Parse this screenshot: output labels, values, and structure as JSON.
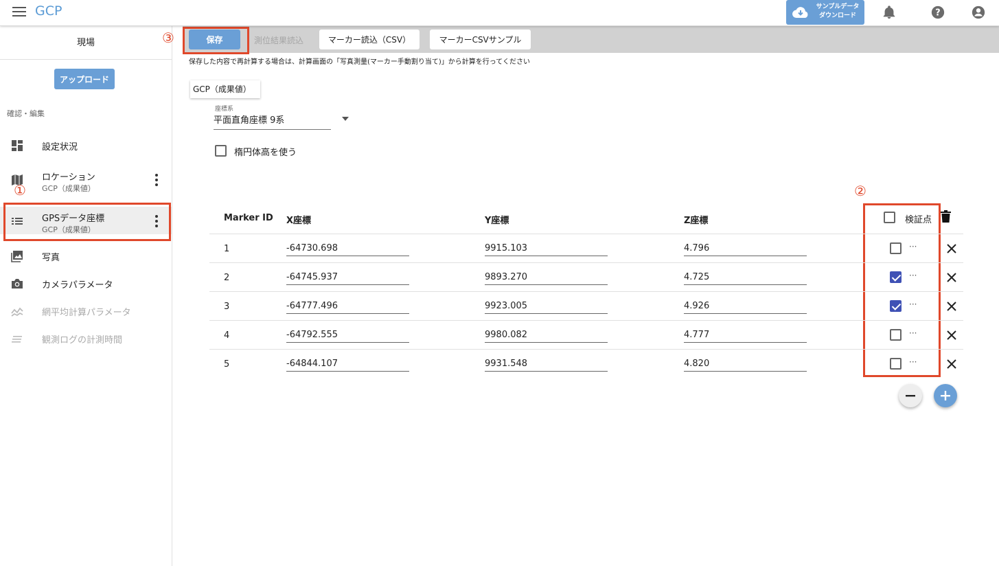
{
  "header": {
    "app_title": "GCP",
    "download_line1": "サンプルデータ",
    "download_line2": "ダウンロード"
  },
  "sidebar": {
    "site_label": "現場",
    "upload_label": "アップロード",
    "section_label": "確認・編集",
    "items": [
      {
        "label": "設定状況",
        "sub": "",
        "icon": "dashboard-icon"
      },
      {
        "label": "ロケーション",
        "sub": "GCP（成果値）",
        "icon": "map-icon"
      },
      {
        "label": "GPSデータ座標",
        "sub": "GCP（成果値）",
        "icon": "list-icon"
      },
      {
        "label": "写真",
        "sub": "",
        "icon": "photo-icon"
      },
      {
        "label": "カメラパラメータ",
        "sub": "",
        "icon": "camera-icon"
      },
      {
        "label": "網平均計算パラメータ",
        "sub": "",
        "icon": "network-icon"
      },
      {
        "label": "観測ログの計測時間",
        "sub": "",
        "icon": "log-lines-icon"
      }
    ]
  },
  "annotations": {
    "one": "①",
    "two": "②",
    "three": "③"
  },
  "toolbar": {
    "save_label": "保存",
    "load_result_label": "測位結果読込",
    "load_marker_label": "マーカー読込（CSV）",
    "marker_sample_label": "マーカーCSVサンプル"
  },
  "notice": "保存した内容で再計算する場合は、計算画面の「写真測量(マーカー手動割り当て)」から計算を行ってください",
  "tab_label": "GCP（成果値）",
  "coord": {
    "label": "座標系",
    "value": "平面直角座標 9系"
  },
  "ellipsoid_label": "楕円体高を使う",
  "table": {
    "headers": {
      "id": "Marker ID",
      "x": "X座標",
      "y": "Y座標",
      "z": "Z座標",
      "verify": "検証点"
    },
    "rows": [
      {
        "id": "1",
        "x": "-64730.698",
        "y": "9915.103",
        "z": "4.796",
        "checked": false
      },
      {
        "id": "2",
        "x": "-64745.937",
        "y": "9893.270",
        "z": "4.725",
        "checked": true
      },
      {
        "id": "3",
        "x": "-64777.496",
        "y": "9923.005",
        "z": "4.926",
        "checked": true
      },
      {
        "id": "4",
        "x": "-64792.555",
        "y": "9980.082",
        "z": "4.777",
        "checked": false
      },
      {
        "id": "5",
        "x": "-64844.107",
        "y": "9931.548",
        "z": "4.820",
        "checked": false
      }
    ],
    "row_more": "···"
  },
  "colors": {
    "accent": "#6a9fd6",
    "annotation_red": "#e0482b",
    "checkbox_checked": "#3f51b5"
  }
}
